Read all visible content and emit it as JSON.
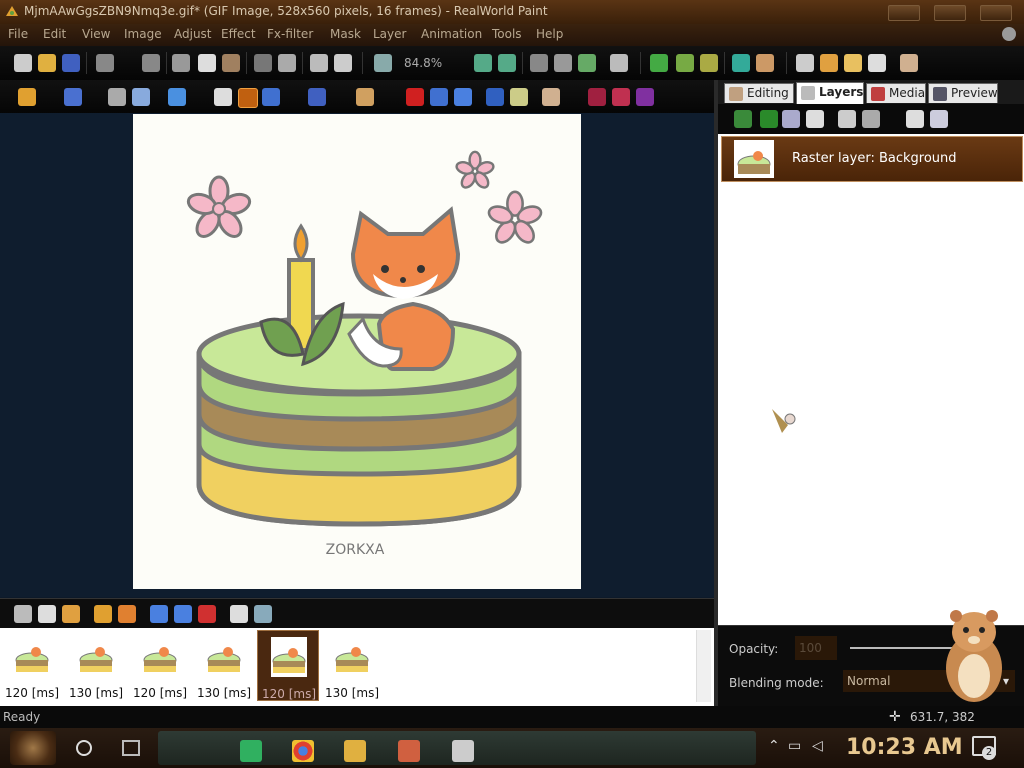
{
  "window": {
    "title": "MjmAAwGgsZBN9Nmq3e.gif* (GIF Image, 528x560 pixels, 16 frames) - RealWorld Paint"
  },
  "menu": [
    "File",
    "Edit",
    "View",
    "Image",
    "Adjust",
    "Effect",
    "Fx-filter",
    "Mask",
    "Layer",
    "Animation",
    "Tools",
    "Help"
  ],
  "toolbar": {
    "zoom": "84.8%"
  },
  "image": {
    "watermark": "ZORKXA"
  },
  "panel": {
    "tabs": [
      "Editing",
      "Layers",
      "Media",
      "Preview"
    ],
    "active_tab": "Layers",
    "layer_name": "Raster layer: Background",
    "opacity_label": "Opacity:",
    "opacity_value": "100",
    "blend_label": "Blending mode:",
    "blend_value": "Normal"
  },
  "frames": [
    {
      "time": "120 [ms]",
      "selected": false
    },
    {
      "time": "130 [ms]",
      "selected": false
    },
    {
      "time": "120 [ms]",
      "selected": false
    },
    {
      "time": "130 [ms]",
      "selected": false
    },
    {
      "time": "120 [ms]",
      "selected": true
    },
    {
      "time": "130 [ms]",
      "selected": false
    }
  ],
  "status": {
    "text": "Ready",
    "coords": "631.7, 382"
  },
  "taskbar": {
    "clock": "10:23 AM",
    "notification_count": "2"
  },
  "colors": {
    "title_bg": "#5a3414",
    "selection_bg": "#6a3a14",
    "canvas_bg": "#0f1d2e",
    "clock": "#e8c890"
  }
}
